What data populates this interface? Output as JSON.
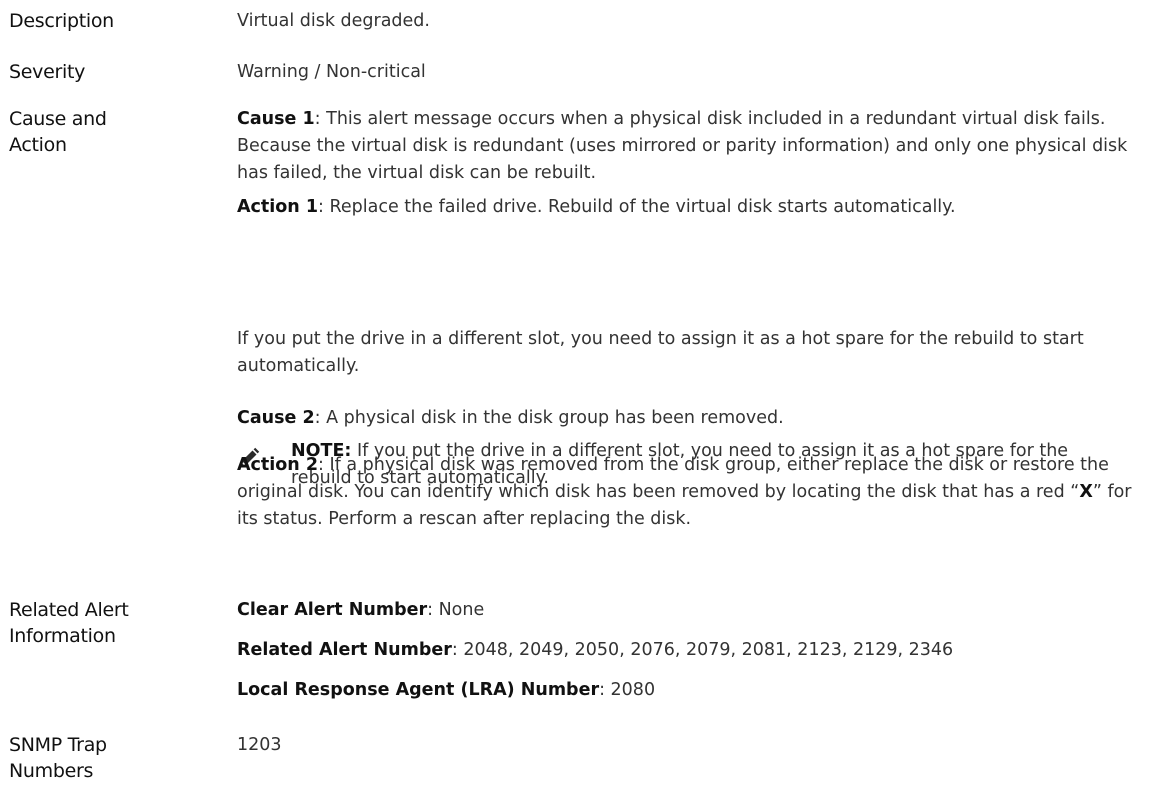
{
  "rows": {
    "description": {
      "label": "Description",
      "value": "Virtual disk degraded."
    },
    "severity": {
      "label": "Severity",
      "value": "Warning / Non-critical"
    },
    "cause_action": {
      "label_line1": "Cause and",
      "label_line2": "Action",
      "cause1_label": "Cause 1",
      "cause1_text": ": This alert message occurs when a physical disk included in a redundant virtual disk fails. Because the virtual disk is redundant (uses mirrored or parity information) and only one physical disk has failed, the virtual disk can be rebuilt.",
      "action1_label": "Action 1",
      "action1_text": ": Replace the failed drive. Rebuild of the virtual disk starts automatically.",
      "note_icon": "pencil-note-icon",
      "note_label": "NOTE:",
      "note_text": " If you put the drive in a different slot, you need to assign it as a hot spare for the rebuild to start automatically.",
      "repeat_text": "If you put the drive in a different slot, you need to assign it as a hot spare for the rebuild to start automatically.",
      "cause2_label": "Cause 2",
      "cause2_text": ": A physical disk in the disk group has been removed.",
      "action2_label": "Action 2",
      "action2_text_a": ": If a physical disk was removed from the disk group, either replace the disk or restore the original disk. You can identify which disk has been removed by locating the disk that has a red “",
      "action2_x": "X",
      "action2_text_b": "” for its status. Perform a rescan after replacing the disk."
    },
    "related": {
      "label_line1": "Related Alert",
      "label_line2": "Information",
      "clear_label": "Clear Alert Number",
      "clear_value": ": None",
      "related_label": "Related Alert Number",
      "related_value": ": 2048, 2049, 2050, 2076, 2079, 2081, 2123, 2129, 2346",
      "lra_label": "Local Response Agent (LRA) Number",
      "lra_value": ": 2080"
    },
    "snmp": {
      "label_line1": "SNMP Trap",
      "label_line2": "Numbers",
      "value": "1203"
    }
  }
}
